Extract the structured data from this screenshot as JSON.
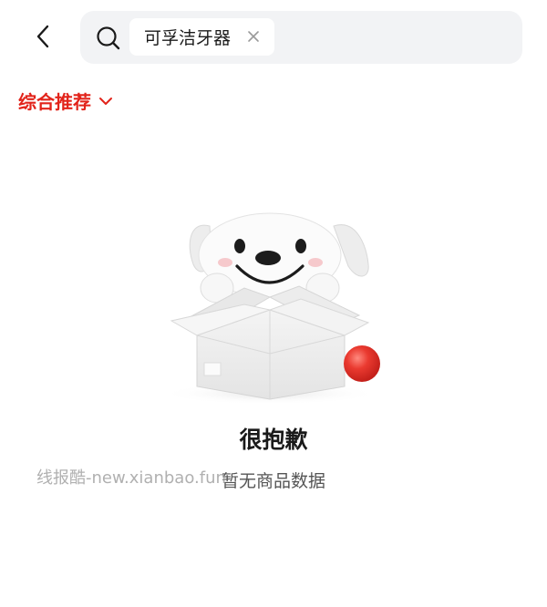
{
  "header": {
    "back_icon": "chevron-left-icon",
    "search": {
      "icon": "search-icon",
      "query_chip": "可孚洁牙器",
      "clear_icon": "close-icon"
    }
  },
  "filter": {
    "sort_label": "综合推荐",
    "sort_icon": "chevron-down-icon"
  },
  "empty_state": {
    "illustration": "dog-in-box-illustration",
    "title": "很抱歉",
    "subtitle": "暂无商品数据"
  },
  "watermark": "线报酷-new.xianbao.fun",
  "colors": {
    "accent": "#e2231a",
    "search_bg": "#f2f3f5",
    "text": "#1a1a1a",
    "ball": "#e8332b"
  }
}
